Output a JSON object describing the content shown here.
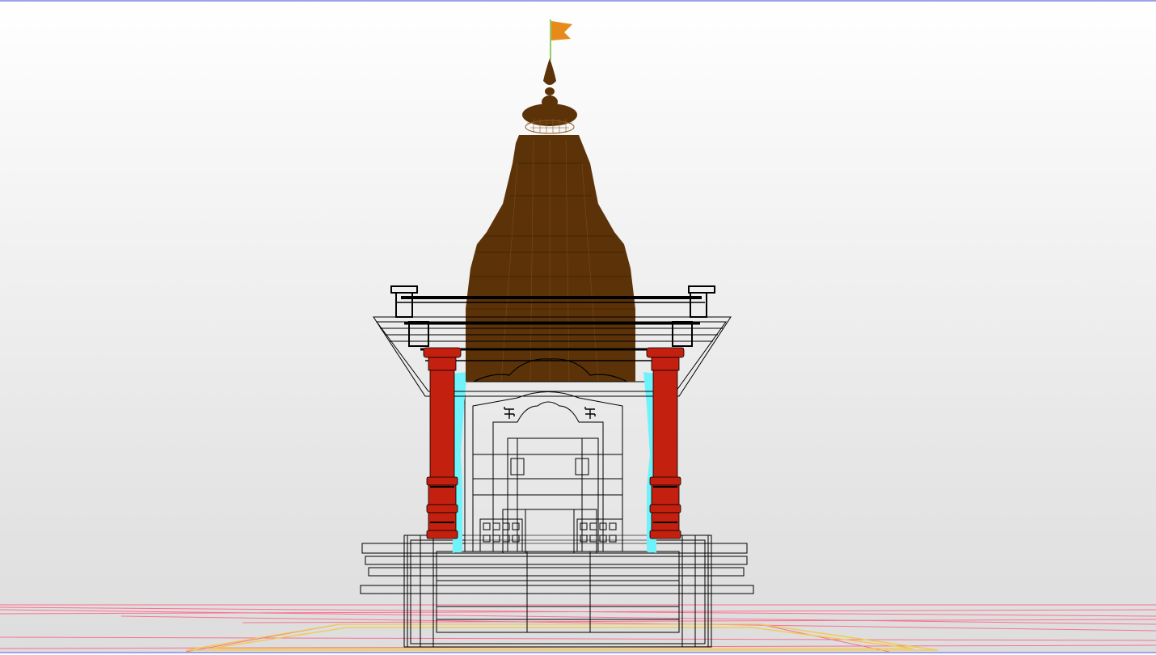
{
  "viewport": {
    "background_top": "#ffffff",
    "background_bottom": "#dddddd",
    "frame_color": "#9da4e6"
  },
  "model": {
    "shikhara_color": "#5c3308",
    "pillar_color": "#c4200f",
    "glass_color": "#6ff3fb",
    "flag_color": "#e88a1a",
    "ground_grid_color": "#ff5e84",
    "ground_outline_color": "#f2c84a",
    "wireframe_color": "#000000"
  }
}
